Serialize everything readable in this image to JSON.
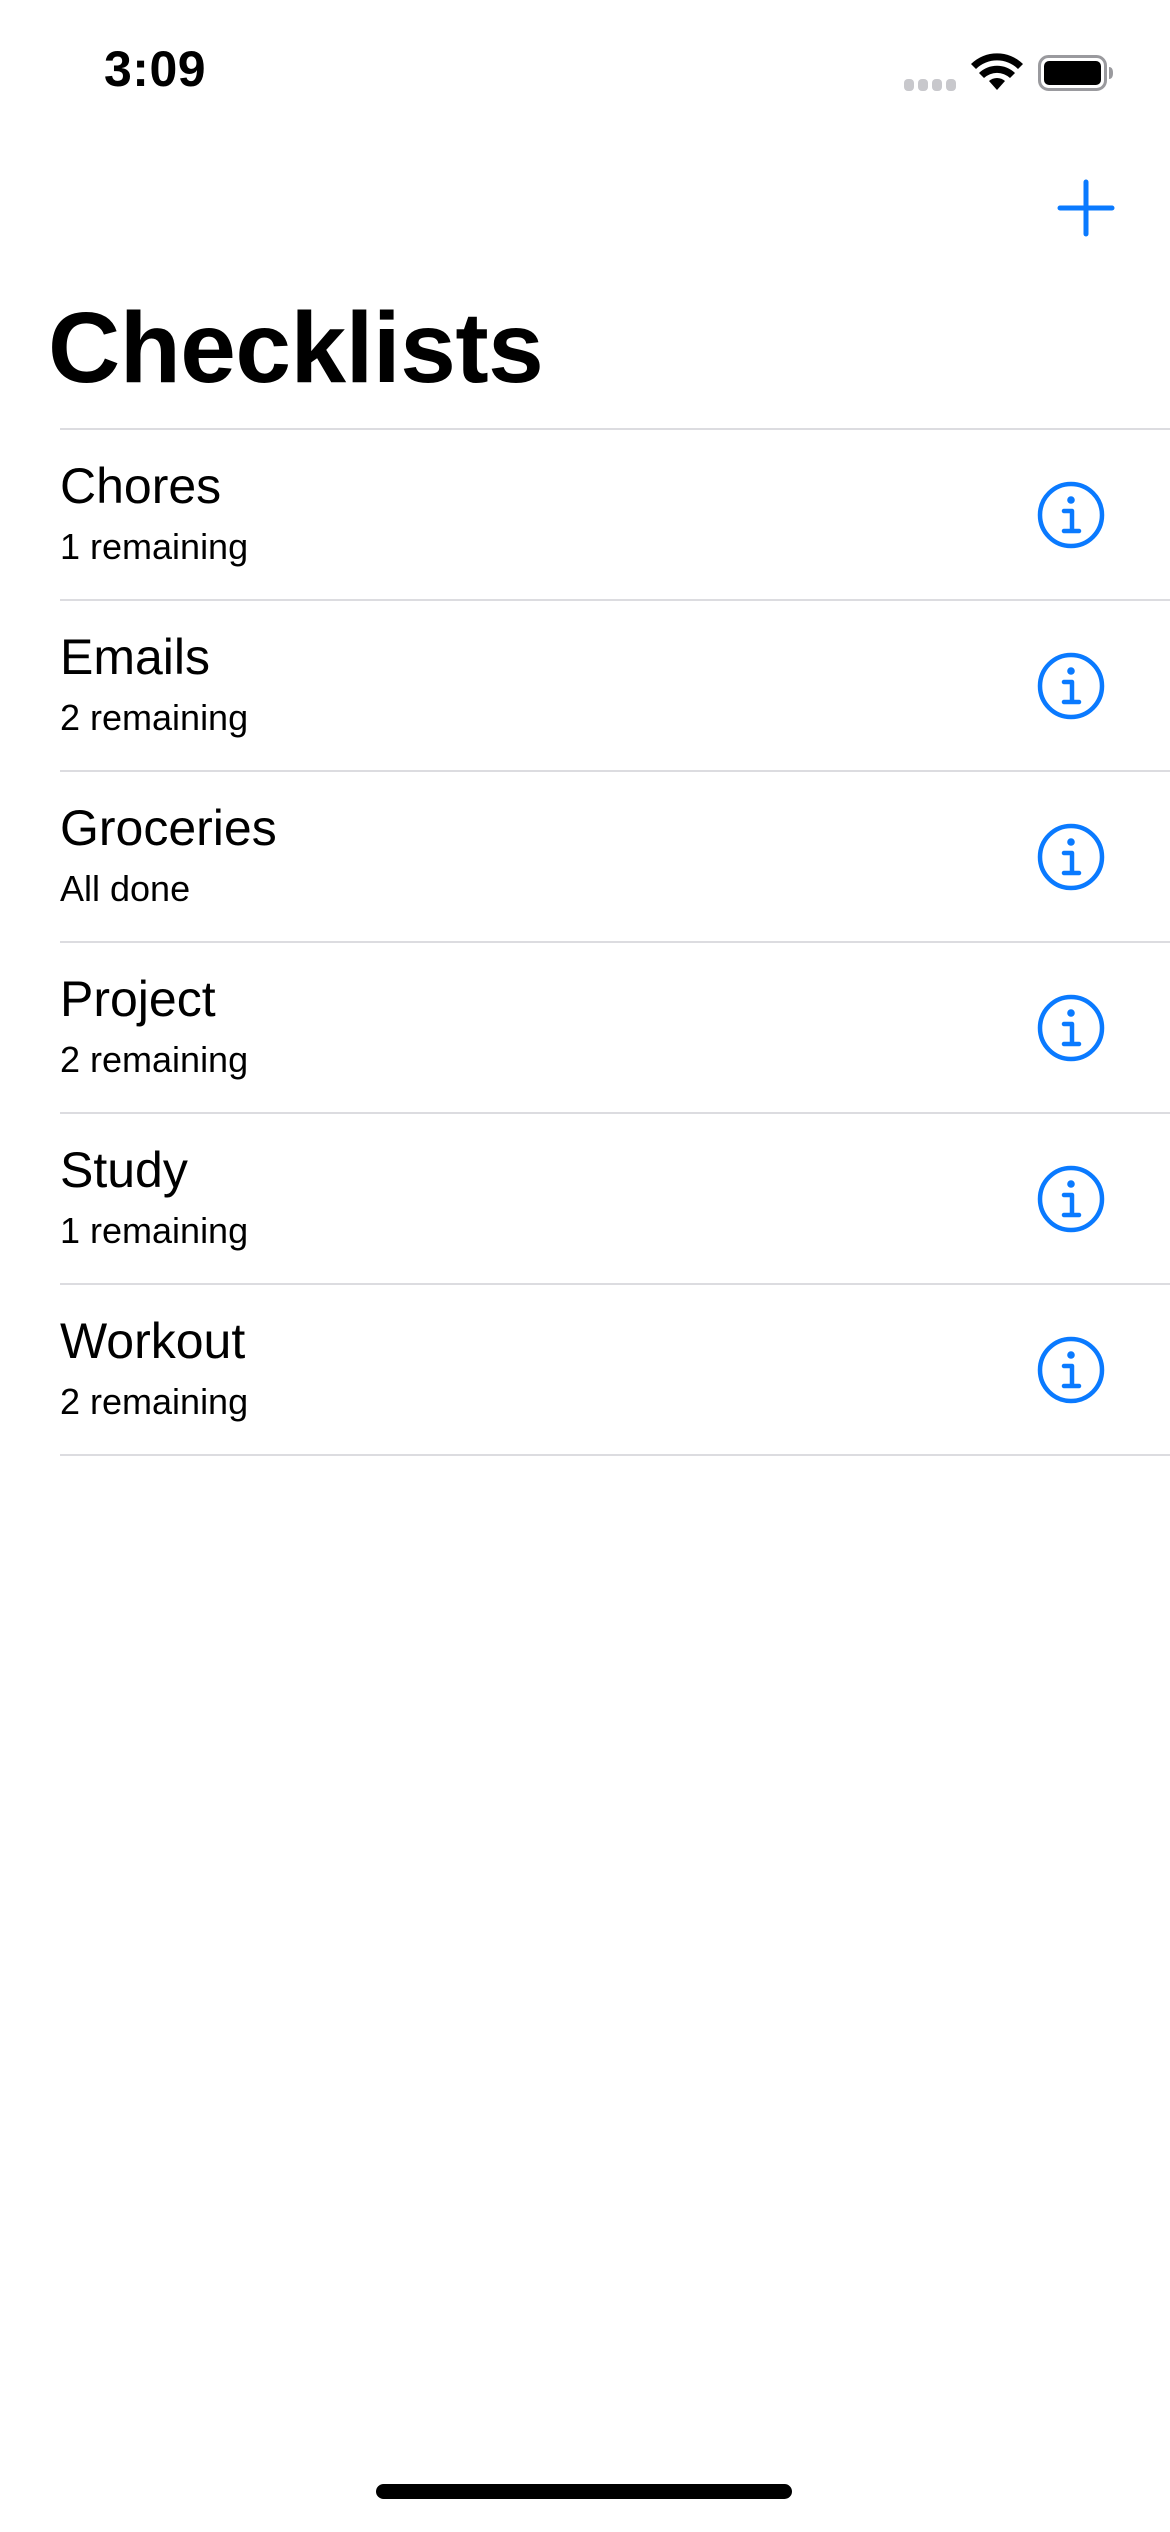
{
  "status_bar": {
    "time": "3:09"
  },
  "nav": {
    "add_icon": "plus-icon",
    "title": "Checklists"
  },
  "colors": {
    "accent": "#0a7aff",
    "separator": "#dcdce0",
    "text": "#000000",
    "background": "#ffffff"
  },
  "checklists": [
    {
      "name": "Chores",
      "status": "1 remaining"
    },
    {
      "name": "Emails",
      "status": "2 remaining"
    },
    {
      "name": "Groceries",
      "status": "All done"
    },
    {
      "name": "Project",
      "status": "2 remaining"
    },
    {
      "name": "Study",
      "status": "1 remaining"
    },
    {
      "name": "Workout",
      "status": "2 remaining"
    }
  ],
  "row_accessory_icon": "info-circle-icon"
}
